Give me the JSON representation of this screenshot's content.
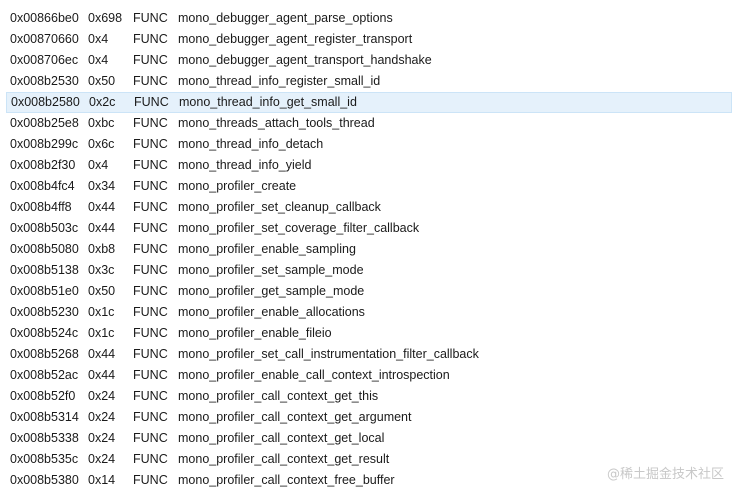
{
  "symbols": [
    {
      "address": "0x00866be0",
      "size": "0x698",
      "type": "FUNC",
      "name": "mono_debugger_agent_parse_options"
    },
    {
      "address": "0x00870660",
      "size": "0x4",
      "type": "FUNC",
      "name": "mono_debugger_agent_register_transport"
    },
    {
      "address": "0x008706ec",
      "size": "0x4",
      "type": "FUNC",
      "name": "mono_debugger_agent_transport_handshake"
    },
    {
      "address": "0x008b2530",
      "size": "0x50",
      "type": "FUNC",
      "name": "mono_thread_info_register_small_id"
    },
    {
      "address": "0x008b2580",
      "size": "0x2c",
      "type": "FUNC",
      "name": "mono_thread_info_get_small_id"
    },
    {
      "address": "0x008b25e8",
      "size": "0xbc",
      "type": "FUNC",
      "name": "mono_threads_attach_tools_thread"
    },
    {
      "address": "0x008b299c",
      "size": "0x6c",
      "type": "FUNC",
      "name": "mono_thread_info_detach"
    },
    {
      "address": "0x008b2f30",
      "size": "0x4",
      "type": "FUNC",
      "name": "mono_thread_info_yield"
    },
    {
      "address": "0x008b4fc4",
      "size": "0x34",
      "type": "FUNC",
      "name": "mono_profiler_create"
    },
    {
      "address": "0x008b4ff8",
      "size": "0x44",
      "type": "FUNC",
      "name": "mono_profiler_set_cleanup_callback"
    },
    {
      "address": "0x008b503c",
      "size": "0x44",
      "type": "FUNC",
      "name": "mono_profiler_set_coverage_filter_callback"
    },
    {
      "address": "0x008b5080",
      "size": "0xb8",
      "type": "FUNC",
      "name": "mono_profiler_enable_sampling"
    },
    {
      "address": "0x008b5138",
      "size": "0x3c",
      "type": "FUNC",
      "name": "mono_profiler_set_sample_mode"
    },
    {
      "address": "0x008b51e0",
      "size": "0x50",
      "type": "FUNC",
      "name": "mono_profiler_get_sample_mode"
    },
    {
      "address": "0x008b5230",
      "size": "0x1c",
      "type": "FUNC",
      "name": "mono_profiler_enable_allocations"
    },
    {
      "address": "0x008b524c",
      "size": "0x1c",
      "type": "FUNC",
      "name": "mono_profiler_enable_fileio"
    },
    {
      "address": "0x008b5268",
      "size": "0x44",
      "type": "FUNC",
      "name": "mono_profiler_set_call_instrumentation_filter_callback"
    },
    {
      "address": "0x008b52ac",
      "size": "0x44",
      "type": "FUNC",
      "name": "mono_profiler_enable_call_context_introspection"
    },
    {
      "address": "0x008b52f0",
      "size": "0x24",
      "type": "FUNC",
      "name": "mono_profiler_call_context_get_this"
    },
    {
      "address": "0x008b5314",
      "size": "0x24",
      "type": "FUNC",
      "name": "mono_profiler_call_context_get_argument"
    },
    {
      "address": "0x008b5338",
      "size": "0x24",
      "type": "FUNC",
      "name": "mono_profiler_call_context_get_local"
    },
    {
      "address": "0x008b535c",
      "size": "0x24",
      "type": "FUNC",
      "name": "mono_profiler_call_context_get_result"
    },
    {
      "address": "0x008b5380",
      "size": "0x14",
      "type": "FUNC",
      "name": "mono_profiler_call_context_free_buffer"
    }
  ],
  "selected_index": 4,
  "watermark": "@稀土掘金技术社区",
  "colors": {
    "selection_bg": "#e5f1fb",
    "selection_border": "#cce4f7",
    "text": "#1a1a1a"
  }
}
